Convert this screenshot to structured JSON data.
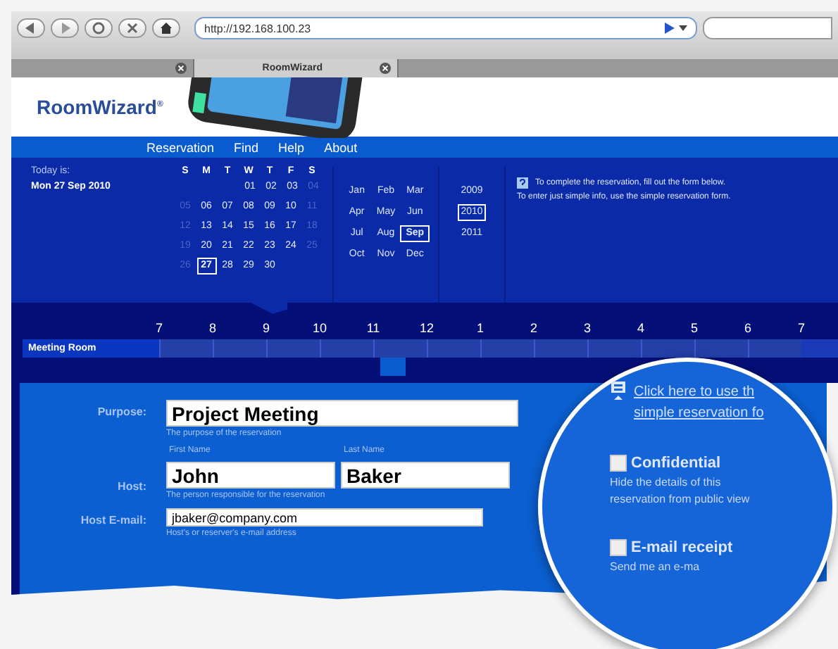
{
  "browser": {
    "url": "http://192.168.100.23",
    "tabs": [
      {
        "selected": false
      },
      {
        "title": "RoomWizard",
        "selected": true
      }
    ]
  },
  "logo": {
    "name": "RoomWizard",
    "mark": "®"
  },
  "nav": [
    "Reservation",
    "Find",
    "Help",
    "About"
  ],
  "today": {
    "label": "Today is:",
    "date": "Mon 27 Sep 2010"
  },
  "calendar": {
    "weekdays": [
      "S",
      "M",
      "T",
      "W",
      "T",
      "F",
      "S"
    ],
    "weeks": [
      [
        {
          "label": "01",
          "dim": false,
          "selected": false
        },
        {
          "label": "02",
          "dim": false,
          "selected": false
        },
        {
          "label": "03",
          "dim": false,
          "selected": false
        },
        {
          "label": "04",
          "dim": true,
          "selected": false
        }
      ],
      [
        {
          "label": "05",
          "dim": true,
          "selected": false
        },
        {
          "label": "06",
          "dim": false,
          "selected": false
        },
        {
          "label": "07",
          "dim": false,
          "selected": false
        },
        {
          "label": "08",
          "dim": false,
          "selected": false
        },
        {
          "label": "09",
          "dim": false,
          "selected": false
        },
        {
          "label": "10",
          "dim": false,
          "selected": false
        },
        {
          "label": "11",
          "dim": true,
          "selected": false
        }
      ],
      [
        {
          "label": "12",
          "dim": true,
          "selected": false
        },
        {
          "label": "13",
          "dim": false,
          "selected": false
        },
        {
          "label": "14",
          "dim": false,
          "selected": false
        },
        {
          "label": "15",
          "dim": false,
          "selected": false
        },
        {
          "label": "16",
          "dim": false,
          "selected": false
        },
        {
          "label": "17",
          "dim": false,
          "selected": false
        },
        {
          "label": "18",
          "dim": true,
          "selected": false
        }
      ],
      [
        {
          "label": "19",
          "dim": true,
          "selected": false
        },
        {
          "label": "20",
          "dim": false,
          "selected": false
        },
        {
          "label": "21",
          "dim": false,
          "selected": false
        },
        {
          "label": "22",
          "dim": false,
          "selected": false
        },
        {
          "label": "23",
          "dim": false,
          "selected": false
        },
        {
          "label": "24",
          "dim": false,
          "selected": false
        },
        {
          "label": "25",
          "dim": true,
          "selected": false
        }
      ],
      [
        {
          "label": "26",
          "dim": true,
          "selected": false
        },
        {
          "label": "27",
          "dim": false,
          "selected": true
        },
        {
          "label": "28",
          "dim": false,
          "selected": false
        },
        {
          "label": "29",
          "dim": false,
          "selected": false
        },
        {
          "label": "30",
          "dim": false,
          "selected": false
        }
      ]
    ],
    "months": [
      {
        "label": "Jan",
        "selected": false
      },
      {
        "label": "Feb",
        "selected": false
      },
      {
        "label": "Mar",
        "selected": false
      },
      {
        "label": "Apr",
        "selected": false
      },
      {
        "label": "May",
        "selected": false
      },
      {
        "label": "Jun",
        "selected": false
      },
      {
        "label": "Jul",
        "selected": false
      },
      {
        "label": "Aug",
        "selected": false
      },
      {
        "label": "Sep",
        "selected": true
      },
      {
        "label": "Oct",
        "selected": false
      },
      {
        "label": "Nov",
        "selected": false
      },
      {
        "label": "Dec",
        "selected": false
      }
    ],
    "years": [
      {
        "label": "2009",
        "selected": false
      },
      {
        "label": "2010",
        "selected": true
      },
      {
        "label": "2011",
        "selected": false
      }
    ]
  },
  "info": [
    "To complete the reservation, fill out the form below.",
    "To enter just simple info, use the simple reservation form."
  ],
  "timeline": {
    "hours": [
      "7",
      "8",
      "9",
      "10",
      "11",
      "12",
      "1",
      "2",
      "3",
      "4",
      "5",
      "6",
      "7"
    ],
    "rooms": [
      {
        "name": "Meeting Room"
      }
    ]
  },
  "form": {
    "purpose": {
      "label": "Purpose:",
      "value": "Project Meeting",
      "hint": "The purpose of the reservation"
    },
    "host": {
      "label": "Host:",
      "first_label": "First Name",
      "first_value": "John",
      "last_label": "Last Name",
      "last_value": "Baker",
      "hint": "The person responsible for the reservation"
    },
    "email": {
      "label": "Host E-mail:",
      "value": "jbaker@company.com",
      "hint": "Host's or reserver's e-mail address"
    }
  },
  "magnifier": {
    "link": [
      "Click here to use th",
      "simple reservation fo"
    ],
    "options": [
      {
        "kind": "checkbox",
        "label": "Confidential",
        "checked": false,
        "description": "Hide the details of this reservation from public view"
      },
      {
        "kind": "checkbox",
        "label": "E-mail receipt",
        "checked": false,
        "description": "Send me an e-ma"
      }
    ]
  }
}
